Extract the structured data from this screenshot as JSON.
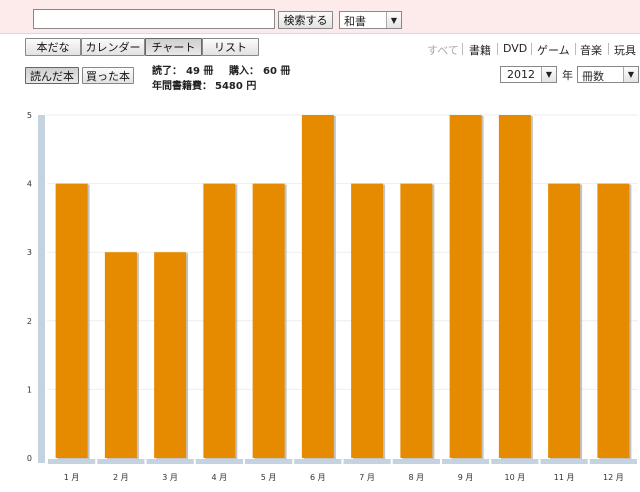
{
  "search": {
    "value": "",
    "button_label": "検索する",
    "type_selected": "和書"
  },
  "view_tabs": [
    {
      "label": "本だな",
      "active": false
    },
    {
      "label": "カレンダー",
      "active": false
    },
    {
      "label": "チャート",
      "active": true
    },
    {
      "label": "リスト",
      "active": false
    }
  ],
  "categories": [
    {
      "label": "すべて",
      "active": true
    },
    {
      "label": "書籍",
      "active": false
    },
    {
      "label": "DVD",
      "active": false
    },
    {
      "label": "ゲーム",
      "active": false
    },
    {
      "label": "音楽",
      "active": false
    },
    {
      "label": "玩具",
      "active": false
    }
  ],
  "toggles": [
    {
      "label": "読んだ本",
      "active": true
    },
    {
      "label": "買った本",
      "active": false
    }
  ],
  "stats": {
    "read_label": "読了：",
    "read_value": "49 冊",
    "bought_label": "購入：",
    "bought_value": "60 冊",
    "spending_label": "年間書籍費：",
    "spending_value": "5480 円"
  },
  "filters": {
    "year": "2012",
    "year_unit": "年",
    "metric": "冊数"
  },
  "colors": {
    "bar": "#e68a00",
    "bar_shadow": "#a9a9a9",
    "axis": "#c5d3e0",
    "grid": "#eeeeee",
    "toolbar_bg": "#fdeaea"
  },
  "icons": {
    "dropdown": "chevron-down-icon"
  },
  "chart_data": {
    "type": "bar",
    "categories": [
      "1 月",
      "2 月",
      "3 月",
      "4 月",
      "5 月",
      "6 月",
      "7 月",
      "8 月",
      "9 月",
      "10 月",
      "11 月",
      "12 月"
    ],
    "values": [
      4,
      3,
      3,
      4,
      4,
      5,
      4,
      4,
      5,
      5,
      4,
      4
    ],
    "ylim": [
      0,
      5
    ],
    "yticks": [
      "0",
      "1",
      "2",
      "3",
      "4",
      "5"
    ],
    "title": "",
    "xlabel": "",
    "ylabel": "",
    "grid": true,
    "legend": "none"
  }
}
